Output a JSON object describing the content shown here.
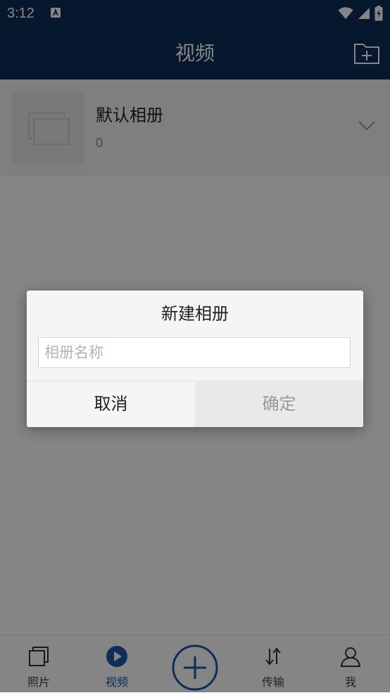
{
  "status_bar": {
    "time": "3:12"
  },
  "app_bar": {
    "title": "视频"
  },
  "albums": [
    {
      "name": "默认相册",
      "count": "0"
    }
  ],
  "bottom_nav": {
    "photos": "照片",
    "videos": "视频",
    "transfer": "传输",
    "me": "我"
  },
  "dialog": {
    "title": "新建相册",
    "input_placeholder": "相册名称",
    "input_value": "",
    "cancel_label": "取消",
    "confirm_label": "确定"
  },
  "colors": {
    "header": "#0e2f58",
    "accent": "#1a5aa8",
    "scrim": "rgba(0,0,0,0.48)"
  }
}
